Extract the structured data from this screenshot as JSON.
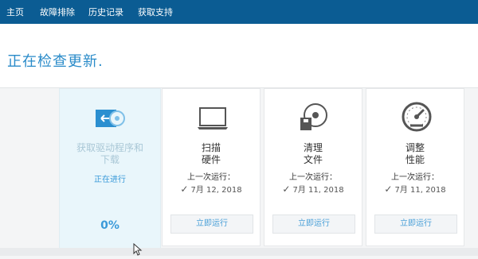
{
  "nav": {
    "items": [
      "主页",
      "故障排除",
      "历史记录",
      "获取支持"
    ]
  },
  "header": {
    "title": "正在检查更新."
  },
  "cards": {
    "drivers": {
      "title_line1": "获取驱动程序和",
      "title_line2": "下载",
      "status": "正在进行",
      "progress_text": "0%",
      "progress": 0,
      "icon": "download-arrow-icon"
    },
    "hardware": {
      "title_line1": "扫描",
      "title_line2": "硬件",
      "last_run_label": "上一次运行：",
      "last_run_date": "7月 12, 2018",
      "button": "立即运行",
      "icon": "laptop-icon"
    },
    "cleanup": {
      "title_line1": "清理",
      "title_line2": "文件",
      "last_run_label": "上一次运行：",
      "last_run_date": "7月 11, 2018",
      "button": "立即运行",
      "icon": "disk-cleanup-icon"
    },
    "performance": {
      "title_line1": "调整",
      "title_line2": "性能",
      "last_run_label": "上一次运行：",
      "last_run_date": "7月 11, 2018",
      "button": "立即运行",
      "icon": "speedometer-icon"
    }
  },
  "colors": {
    "nav_bg": "#0b5c93",
    "accent": "#2a8bc9",
    "active_card_bg": "#e9f6fb"
  }
}
